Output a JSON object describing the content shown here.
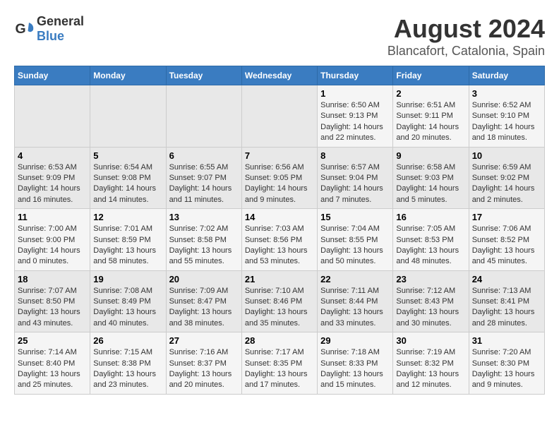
{
  "logo": {
    "general": "General",
    "blue": "Blue"
  },
  "title": "August 2024",
  "subtitle": "Blancafort, Catalonia, Spain",
  "days_of_week": [
    "Sunday",
    "Monday",
    "Tuesday",
    "Wednesday",
    "Thursday",
    "Friday",
    "Saturday"
  ],
  "weeks": [
    [
      {
        "day": "",
        "info": ""
      },
      {
        "day": "",
        "info": ""
      },
      {
        "day": "",
        "info": ""
      },
      {
        "day": "",
        "info": ""
      },
      {
        "day": "1",
        "info": "Sunrise: 6:50 AM\nSunset: 9:13 PM\nDaylight: 14 hours and 22 minutes."
      },
      {
        "day": "2",
        "info": "Sunrise: 6:51 AM\nSunset: 9:11 PM\nDaylight: 14 hours and 20 minutes."
      },
      {
        "day": "3",
        "info": "Sunrise: 6:52 AM\nSunset: 9:10 PM\nDaylight: 14 hours and 18 minutes."
      }
    ],
    [
      {
        "day": "4",
        "info": "Sunrise: 6:53 AM\nSunset: 9:09 PM\nDaylight: 14 hours and 16 minutes."
      },
      {
        "day": "5",
        "info": "Sunrise: 6:54 AM\nSunset: 9:08 PM\nDaylight: 14 hours and 14 minutes."
      },
      {
        "day": "6",
        "info": "Sunrise: 6:55 AM\nSunset: 9:07 PM\nDaylight: 14 hours and 11 minutes."
      },
      {
        "day": "7",
        "info": "Sunrise: 6:56 AM\nSunset: 9:05 PM\nDaylight: 14 hours and 9 minutes."
      },
      {
        "day": "8",
        "info": "Sunrise: 6:57 AM\nSunset: 9:04 PM\nDaylight: 14 hours and 7 minutes."
      },
      {
        "day": "9",
        "info": "Sunrise: 6:58 AM\nSunset: 9:03 PM\nDaylight: 14 hours and 5 minutes."
      },
      {
        "day": "10",
        "info": "Sunrise: 6:59 AM\nSunset: 9:02 PM\nDaylight: 14 hours and 2 minutes."
      }
    ],
    [
      {
        "day": "11",
        "info": "Sunrise: 7:00 AM\nSunset: 9:00 PM\nDaylight: 14 hours and 0 minutes."
      },
      {
        "day": "12",
        "info": "Sunrise: 7:01 AM\nSunset: 8:59 PM\nDaylight: 13 hours and 58 minutes."
      },
      {
        "day": "13",
        "info": "Sunrise: 7:02 AM\nSunset: 8:58 PM\nDaylight: 13 hours and 55 minutes."
      },
      {
        "day": "14",
        "info": "Sunrise: 7:03 AM\nSunset: 8:56 PM\nDaylight: 13 hours and 53 minutes."
      },
      {
        "day": "15",
        "info": "Sunrise: 7:04 AM\nSunset: 8:55 PM\nDaylight: 13 hours and 50 minutes."
      },
      {
        "day": "16",
        "info": "Sunrise: 7:05 AM\nSunset: 8:53 PM\nDaylight: 13 hours and 48 minutes."
      },
      {
        "day": "17",
        "info": "Sunrise: 7:06 AM\nSunset: 8:52 PM\nDaylight: 13 hours and 45 minutes."
      }
    ],
    [
      {
        "day": "18",
        "info": "Sunrise: 7:07 AM\nSunset: 8:50 PM\nDaylight: 13 hours and 43 minutes."
      },
      {
        "day": "19",
        "info": "Sunrise: 7:08 AM\nSunset: 8:49 PM\nDaylight: 13 hours and 40 minutes."
      },
      {
        "day": "20",
        "info": "Sunrise: 7:09 AM\nSunset: 8:47 PM\nDaylight: 13 hours and 38 minutes."
      },
      {
        "day": "21",
        "info": "Sunrise: 7:10 AM\nSunset: 8:46 PM\nDaylight: 13 hours and 35 minutes."
      },
      {
        "day": "22",
        "info": "Sunrise: 7:11 AM\nSunset: 8:44 PM\nDaylight: 13 hours and 33 minutes."
      },
      {
        "day": "23",
        "info": "Sunrise: 7:12 AM\nSunset: 8:43 PM\nDaylight: 13 hours and 30 minutes."
      },
      {
        "day": "24",
        "info": "Sunrise: 7:13 AM\nSunset: 8:41 PM\nDaylight: 13 hours and 28 minutes."
      }
    ],
    [
      {
        "day": "25",
        "info": "Sunrise: 7:14 AM\nSunset: 8:40 PM\nDaylight: 13 hours and 25 minutes."
      },
      {
        "day": "26",
        "info": "Sunrise: 7:15 AM\nSunset: 8:38 PM\nDaylight: 13 hours and 23 minutes."
      },
      {
        "day": "27",
        "info": "Sunrise: 7:16 AM\nSunset: 8:37 PM\nDaylight: 13 hours and 20 minutes."
      },
      {
        "day": "28",
        "info": "Sunrise: 7:17 AM\nSunset: 8:35 PM\nDaylight: 13 hours and 17 minutes."
      },
      {
        "day": "29",
        "info": "Sunrise: 7:18 AM\nSunset: 8:33 PM\nDaylight: 13 hours and 15 minutes."
      },
      {
        "day": "30",
        "info": "Sunrise: 7:19 AM\nSunset: 8:32 PM\nDaylight: 13 hours and 12 minutes."
      },
      {
        "day": "31",
        "info": "Sunrise: 7:20 AM\nSunset: 8:30 PM\nDaylight: 13 hours and 9 minutes."
      }
    ]
  ]
}
